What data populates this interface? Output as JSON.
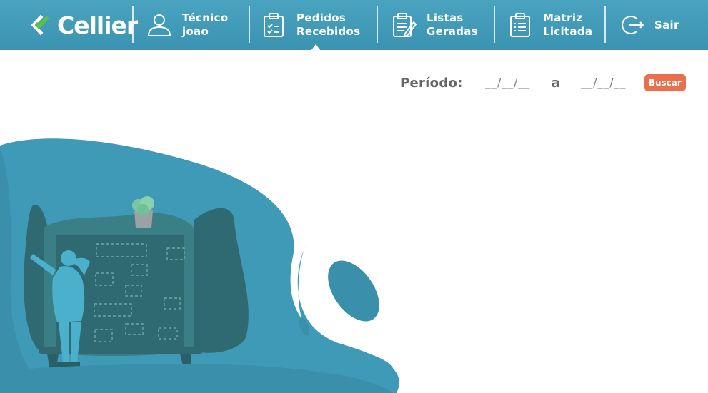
{
  "brand": {
    "name": "Cellier"
  },
  "nav": {
    "user": {
      "line1": "Técnico",
      "line2": "joao"
    },
    "items": [
      {
        "line1": "Pedidos",
        "line2": "Recebidos"
      },
      {
        "line1": "Listas",
        "line2": "Geradas"
      },
      {
        "line1": "Matriz",
        "line2": "Licitada"
      }
    ],
    "logout": {
      "label": "Sair"
    }
  },
  "filter": {
    "periodo_label": "Período:",
    "date_placeholder": "__/__/__",
    "separator": "a",
    "search_label": "Buscar"
  },
  "colors": {
    "header": "#3f9ab8",
    "accent": "#e8704f",
    "illustration_dark": "#3a8fab",
    "illustration_mid": "#3f9ab8"
  }
}
